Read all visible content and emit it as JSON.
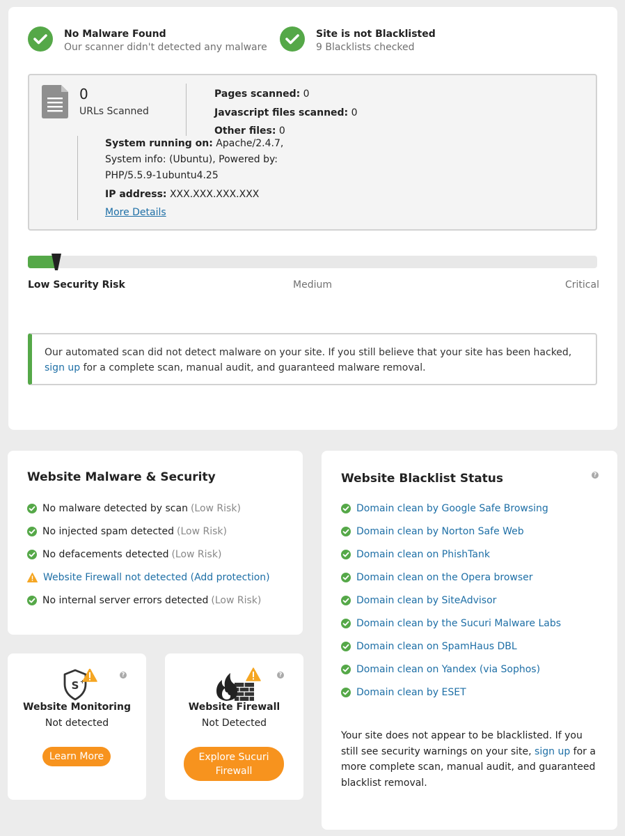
{
  "status": {
    "malware": {
      "title": "No Malware Found",
      "sub": "Our scanner didn't detected any malware",
      "icon": "check-icon"
    },
    "blacklist": {
      "title": "Site is not Blacklisted",
      "sub": "9 Blacklists checked",
      "icon": "check-icon"
    }
  },
  "scan": {
    "urls_count": "0",
    "urls_label": "URLs Scanned",
    "pages_label": "Pages scanned:",
    "pages_value": "0",
    "js_label": "Javascript files scanned:",
    "js_value": "0",
    "other_label": "Other files:",
    "other_value": "0",
    "system_label": "System running on:",
    "system_value": "Apache/2.4.7, System info: (Ubuntu), Powered by: PHP/5.5.9-1ubuntu4.25",
    "ip_label": "IP address:",
    "ip_value": "XXX.XXX.XXX.XXX",
    "more_details": "More Details"
  },
  "risk": {
    "level_fraction": 0.05,
    "low": "Low Security Risk",
    "medium": "Medium",
    "critical": "Critical"
  },
  "notice": {
    "text_before": "Our automated scan did not detect malware on your site. If you still believe that your site has been hacked,",
    "link": "sign up",
    "text_after": "for a complete scan, manual audit, and guaranteed malware removal."
  },
  "malware_section": {
    "title": "Website Malware & Security",
    "items": [
      {
        "text": "No malware detected by scan",
        "note": "(Low Risk)",
        "status": "ok"
      },
      {
        "text": "No injected spam detected",
        "note": "(Low Risk)",
        "status": "ok"
      },
      {
        "text": "No defacements detected",
        "note": "(Low Risk)",
        "status": "ok"
      },
      {
        "text": "Website Firewall not detected (Add protection)",
        "note": "",
        "status": "warn"
      },
      {
        "text": "No internal server errors detected",
        "note": "(Low Risk)",
        "status": "ok"
      }
    ]
  },
  "blacklist_section": {
    "title": "Website Blacklist Status",
    "help": "?",
    "items": [
      "Domain clean by Google Safe Browsing",
      "Domain clean by Norton Safe Web",
      "Domain clean on PhishTank",
      "Domain clean on the Opera browser",
      "Domain clean by SiteAdvisor",
      "Domain clean by the Sucuri Malware Labs",
      "Domain clean on SpamHaus DBL",
      "Domain clean on Yandex (via Sophos)",
      "Domain clean by ESET"
    ],
    "note_before": "Your site does not appear to be blacklisted. If you still see security warnings on your site,",
    "note_link": "sign up",
    "note_after": "for a more complete scan, manual audit, and guaranteed blacklist removal."
  },
  "monitoring": {
    "title": "Website Monitoring",
    "status": "Not detected",
    "button": "Learn More",
    "help": "?",
    "icon": "shield-icon"
  },
  "firewall": {
    "title": "Website Firewall",
    "status": "Not Detected",
    "button_line1": "Explore Sucuri",
    "button_line2": "Firewall",
    "help": "?",
    "icon": "firewall-icon"
  },
  "colors": {
    "green": "#55a848",
    "orange": "#f7931e",
    "link": "#1e6fa6",
    "warning": "#f5a623"
  }
}
